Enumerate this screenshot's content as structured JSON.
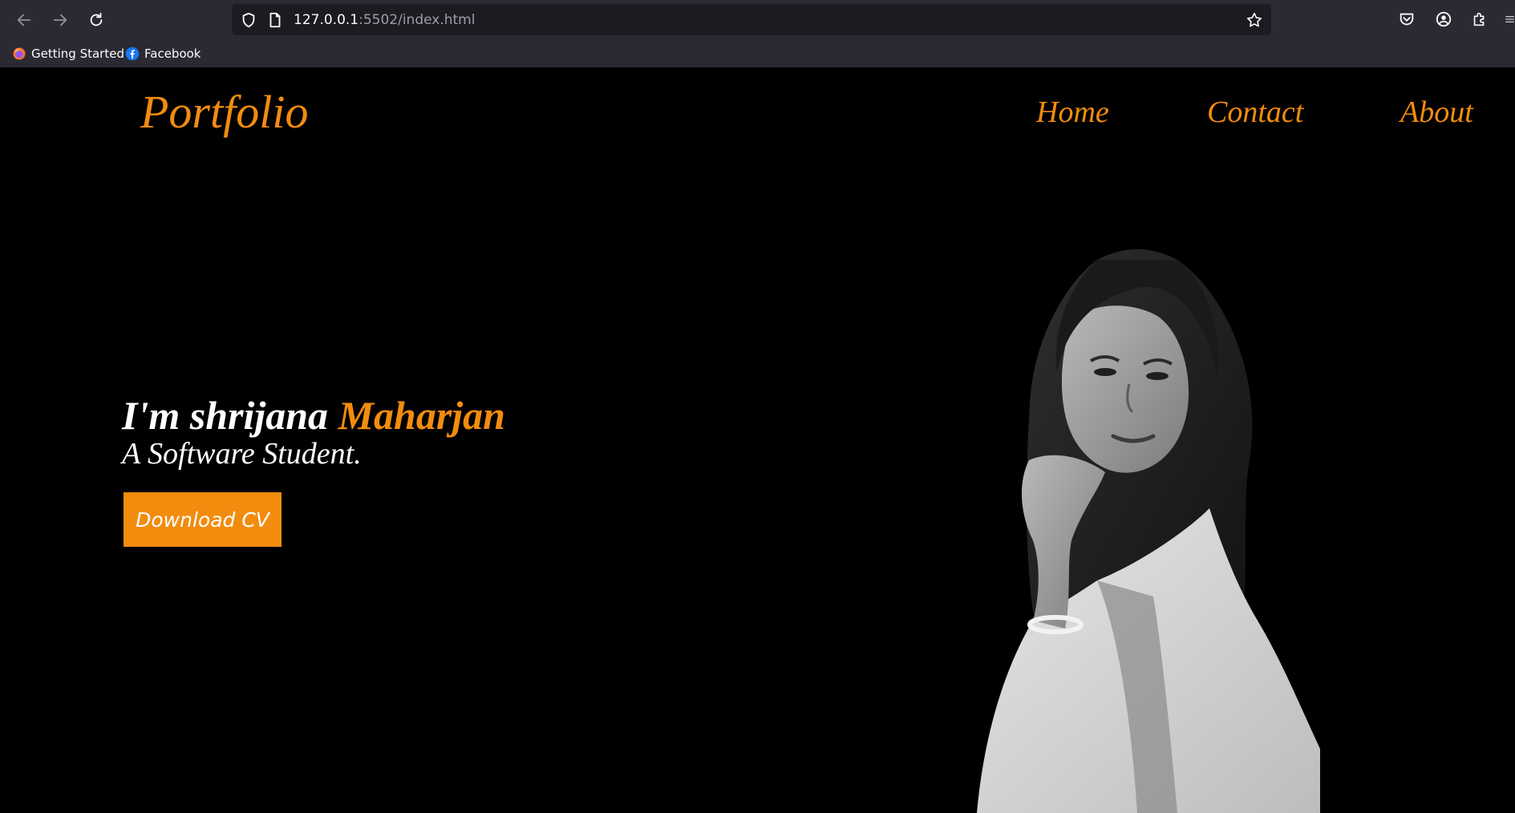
{
  "browser": {
    "url_host": "127.0.0.1",
    "url_path": ":5502/index.html",
    "icons": {
      "back": "arrow-left-icon",
      "forward": "arrow-right-icon",
      "reload": "reload-icon",
      "shield": "shield-icon",
      "page": "page-icon",
      "star": "star-icon",
      "pocket": "pocket-icon",
      "account": "account-icon",
      "extensions": "puzzle-icon",
      "menu": "menu-icon"
    },
    "bookmarks": [
      {
        "label": "Getting Started",
        "icon": "firefox-icon"
      },
      {
        "label": "Facebook",
        "icon": "facebook-icon"
      }
    ]
  },
  "site": {
    "brand": "Portfolio",
    "nav": [
      {
        "label": "Home"
      },
      {
        "label": "Contact"
      },
      {
        "label": "About"
      }
    ],
    "hero": {
      "greeting": "I'm shrijana ",
      "name_accent": "Maharjan",
      "subtitle": "A Software Student.",
      "cta": "Download CV"
    },
    "colors": {
      "accent": "#f28c0f",
      "background": "#000000",
      "text": "#ffffff",
      "chrome": "#2b2a33",
      "urlbar": "#1c1b22"
    }
  }
}
